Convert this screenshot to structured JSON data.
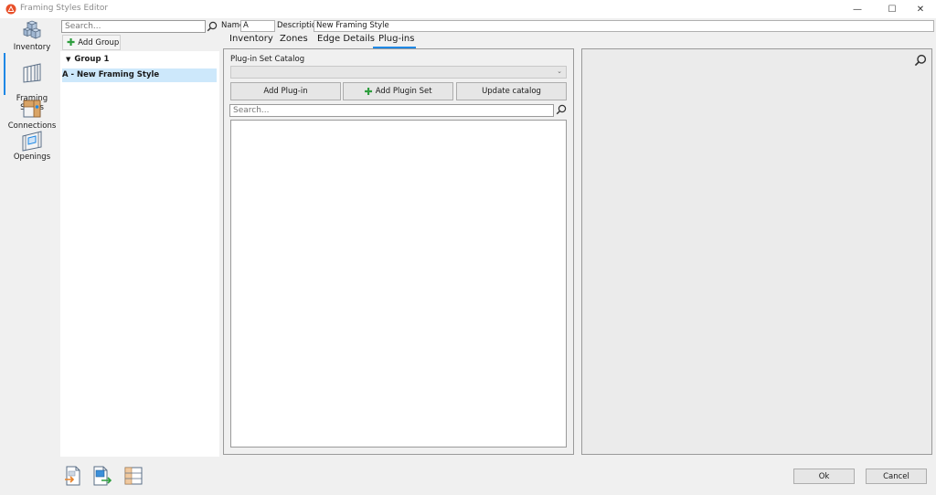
{
  "window": {
    "title": "Framing Styles Editor",
    "minimize_glyph": "—",
    "maximize_glyph": "☐",
    "close_glyph": "✕"
  },
  "nav": {
    "items": [
      {
        "label": "Inventory",
        "icon": "inventory-icon"
      },
      {
        "label": "Framing\nStyles",
        "icon": "framing-styles-icon",
        "active": true
      },
      {
        "label": "Connections",
        "icon": "connections-icon"
      },
      {
        "label": "Openings",
        "icon": "openings-icon"
      }
    ]
  },
  "groups": {
    "search_placeholder": "Search...",
    "add_group_label": "Add Group",
    "group_name": "Group 1",
    "selected_item": "A - New Framing Style"
  },
  "style": {
    "name_label": "Name",
    "name_value": "A",
    "description_label": "Description",
    "description_value": "New Framing Style"
  },
  "tabs": [
    {
      "label": "Inventory"
    },
    {
      "label": "Zones"
    },
    {
      "label": "Edge Details"
    },
    {
      "label": "Plug-ins",
      "active": true
    }
  ],
  "plugins": {
    "catalog_label": "Plug-in Set Catalog",
    "catalog_value": "",
    "add_plugin_label": "Add Plug-in",
    "add_plugin_set_label": "Add Plugin Set",
    "update_catalog_label": "Update catalog",
    "search_placeholder": "Search..."
  },
  "dialog": {
    "ok_label": "Ok",
    "cancel_label": "Cancel"
  },
  "colors": {
    "accent": "#1e88e5",
    "selection": "#cde8fb",
    "add_green": "#2e9e3e"
  }
}
